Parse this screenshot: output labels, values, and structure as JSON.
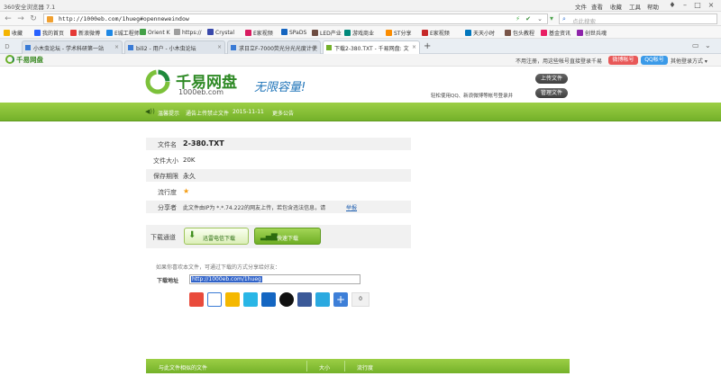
{
  "browser": {
    "title": "360安全浏览器 7.1",
    "menu": [
      "文件",
      "查看",
      "收藏",
      "工具",
      "帮助"
    ],
    "url": "http://1000eb.com/1hueg#openneweindow",
    "search_placeholder": "点此搜索"
  },
  "favorites": [
    "收藏",
    "我的首页",
    "新浪微博",
    "E城工程师",
    "Orient K",
    "https://",
    "Crystal",
    "E家视频",
    "SPaDS",
    "LED产业",
    "游戏商业",
    "ST分享",
    "E家视频",
    "天天小时",
    "包头教程",
    "基金资讯",
    "创世兵魂"
  ],
  "tabs": [
    {
      "label": "小木虫论坛 - 学术科研第一站"
    },
    {
      "label": "bili2 - 用户 - 小木虫论坛"
    },
    {
      "label": "求日立F-7000荧光分光光度计使"
    },
    {
      "label": "下载2-380.TXT - 千易网盘: 文"
    }
  ],
  "site": {
    "logo_text": "千易网盘",
    "topbar_right": "不用注册，用这些帐号直接登录千易",
    "btn_weibo": "微博帐号",
    "btn_qq": "QQ帐号",
    "more_login": "其他登录方式 ▾",
    "brand": "千易网盘",
    "domain": "1000eb.com",
    "slogan": "无限容量!",
    "upload_btn": "上传文件",
    "manage_btn": "管理文件",
    "login_hint": "轻松使用QQ、新浪微博等帐号登录并"
  },
  "announce": {
    "label": "温馨提示",
    "text": "通告上传禁止文件",
    "date": "2015-11-11",
    "more": "更多公告"
  },
  "file": {
    "name_label": "文件名",
    "name": "2-380.TXT",
    "size_label": "文件大小",
    "size": "20K",
    "period_label": "保存期限",
    "period": "永久",
    "hot_label": "流行度",
    "sharer_label": "分享者",
    "sharer_text": "此文件由IP为 *.*.74.222的网友上传，若包含违法信息，请",
    "report": "举报"
  },
  "download": {
    "label": "下载通道",
    "telecom": "迅雷电信下载",
    "unicom": "快速下载"
  },
  "share": {
    "hint": "如果你喜欢本文件，可通过下载的方式分享给好友：",
    "addr_label": "下载地址",
    "addr": "http://1000eb.com/1hueg",
    "count": "0"
  },
  "bottom": {
    "c1": "与此文件相似的文件",
    "c2": "大小",
    "c3": "流行度"
  }
}
